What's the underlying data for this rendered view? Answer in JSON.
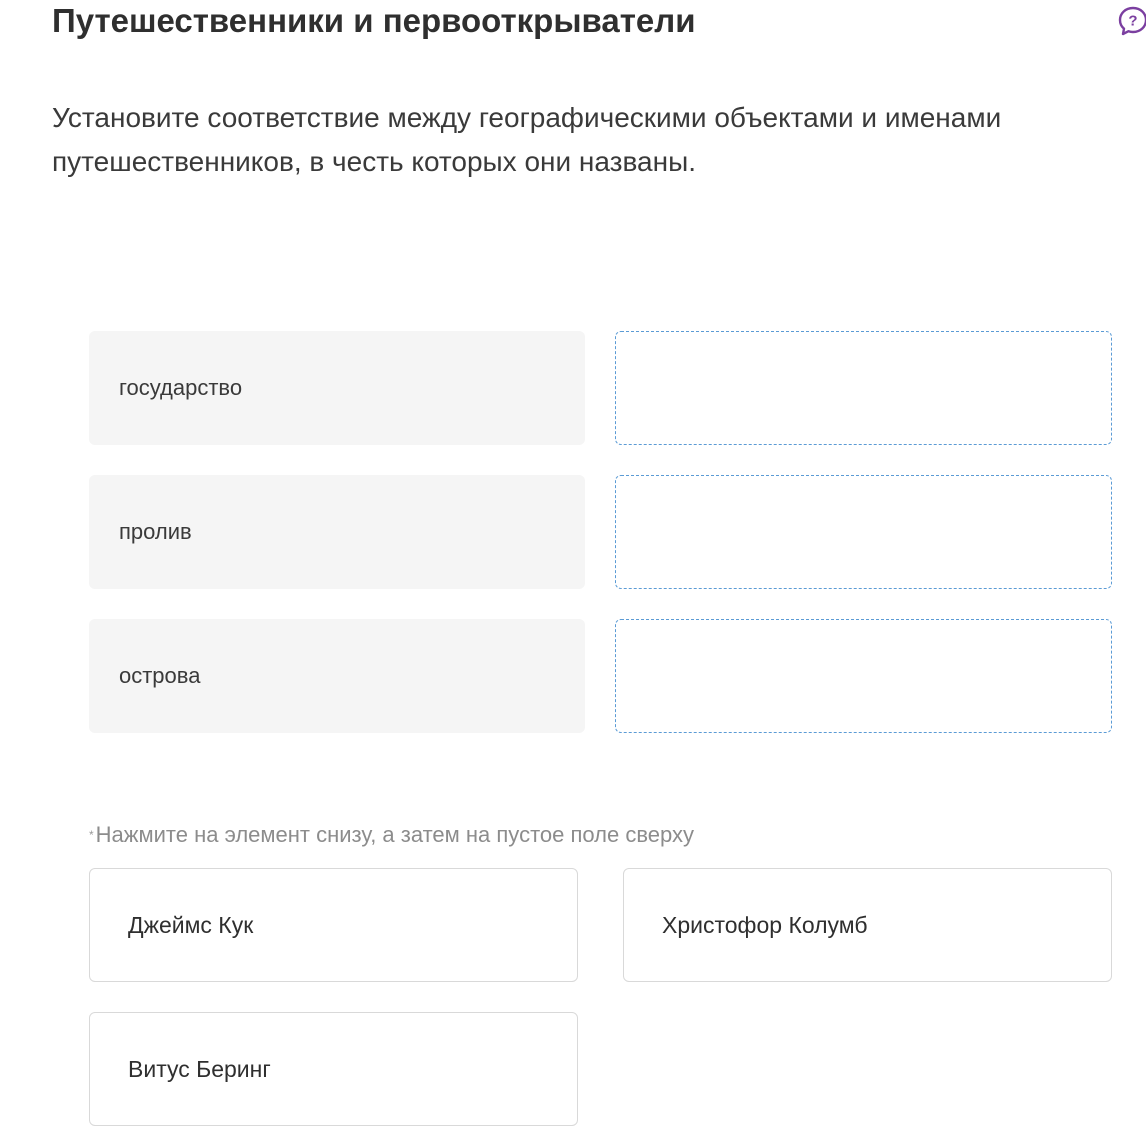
{
  "title": "Путешественники и первооткрыватели",
  "instruction": "Установите соответствие между географическими объектами и именами путешественников, в честь которых они названы.",
  "help_icon": "question-bubble-icon",
  "accent_color": "#7b3fa0",
  "drop_border_color": "#5b9bd5",
  "left_items": [
    "государство",
    "пролив",
    "острова"
  ],
  "hint_mark": "*",
  "hint": "Нажмите на элемент снизу, а затем на пустое поле сверху",
  "options": [
    "Джеймс Кук",
    "Христофор Колумб",
    "Витус Беринг"
  ]
}
